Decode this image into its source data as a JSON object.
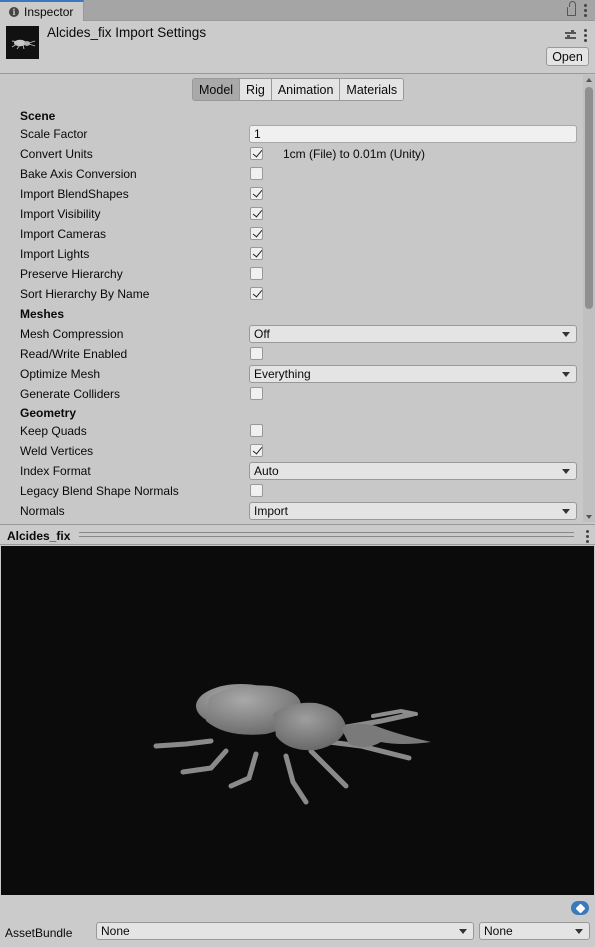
{
  "window": {
    "tab_label": "Inspector"
  },
  "header": {
    "title": "Alcides_fix Import Settings",
    "open_label": "Open"
  },
  "tabs": [
    {
      "label": "Model",
      "active": true
    },
    {
      "label": "Rig",
      "active": false
    },
    {
      "label": "Animation",
      "active": false
    },
    {
      "label": "Materials",
      "active": false
    }
  ],
  "sections": {
    "scene": "Scene",
    "meshes": "Meshes",
    "geometry": "Geometry"
  },
  "settings": {
    "scale_factor": {
      "label": "Scale Factor",
      "value": "1"
    },
    "convert_units": {
      "label": "Convert Units",
      "checked": true,
      "note": "1cm (File) to 0.01m (Unity)"
    },
    "bake_axis": {
      "label": "Bake Axis Conversion",
      "checked": false
    },
    "import_blendshapes": {
      "label": "Import BlendShapes",
      "checked": true
    },
    "import_visibility": {
      "label": "Import Visibility",
      "checked": true
    },
    "import_cameras": {
      "label": "Import Cameras",
      "checked": true
    },
    "import_lights": {
      "label": "Import Lights",
      "checked": true
    },
    "preserve_hierarchy": {
      "label": "Preserve Hierarchy",
      "checked": false
    },
    "sort_hierarchy": {
      "label": "Sort Hierarchy By Name",
      "checked": true
    },
    "mesh_compression": {
      "label": "Mesh Compression",
      "value": "Off"
    },
    "read_write": {
      "label": "Read/Write Enabled",
      "checked": false
    },
    "optimize_mesh": {
      "label": "Optimize Mesh",
      "value": "Everything"
    },
    "generate_colliders": {
      "label": "Generate Colliders",
      "checked": false
    },
    "keep_quads": {
      "label": "Keep Quads",
      "checked": false
    },
    "weld_vertices": {
      "label": "Weld Vertices",
      "checked": true
    },
    "index_format": {
      "label": "Index Format",
      "value": "Auto"
    },
    "legacy_blend": {
      "label": "Legacy Blend Shape Normals",
      "checked": false
    },
    "normals": {
      "label": "Normals",
      "value": "Import"
    }
  },
  "preview": {
    "title": "Alcides_fix"
  },
  "footer": {
    "asset_bundle_label": "AssetBundle",
    "bundle_name": "None",
    "bundle_variant": "None"
  },
  "colors": {
    "accent": "#3a79bb",
    "panel": "#c8c8c8",
    "preview_bg": "#0b0b0b"
  },
  "icons": [
    "info-icon",
    "lock-icon",
    "kebab-icon",
    "sliders-icon",
    "checkmark-icon",
    "dropdown-arrow-icon",
    "tag-icon"
  ]
}
